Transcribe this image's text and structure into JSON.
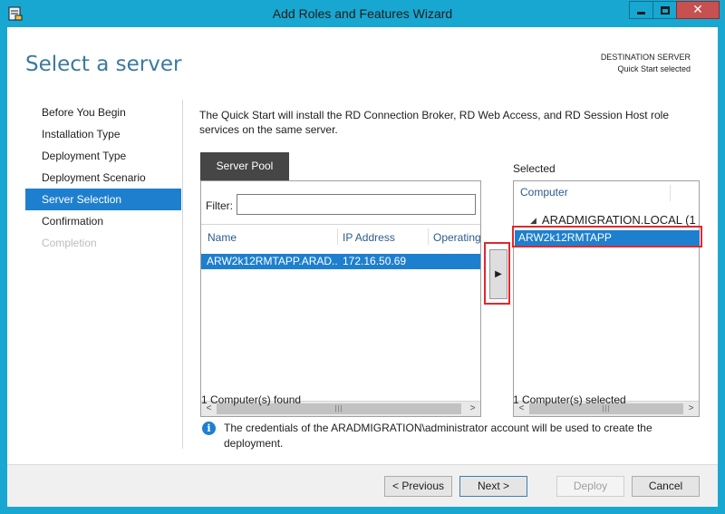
{
  "window": {
    "title": "Add Roles and Features Wizard",
    "close_glyph": "✕"
  },
  "page_title": "Select a server",
  "destination": {
    "label": "DESTINATION SERVER",
    "value": "Quick Start selected"
  },
  "nav": {
    "items": [
      {
        "label": "Before You Begin",
        "state": "normal"
      },
      {
        "label": "Installation Type",
        "state": "normal"
      },
      {
        "label": "Deployment Type",
        "state": "normal"
      },
      {
        "label": "Deployment Scenario",
        "state": "normal"
      },
      {
        "label": "Server Selection",
        "state": "active"
      },
      {
        "label": "Confirmation",
        "state": "normal"
      },
      {
        "label": "Completion",
        "state": "disabled"
      }
    ]
  },
  "intro_text": "The Quick Start will install the RD Connection Broker, RD Web Access, and RD Session Host role services on the same server.",
  "server_pool": {
    "tab_label": "Server Pool",
    "filter_label": "Filter:",
    "filter_value": "",
    "columns": [
      "Name",
      "IP Address",
      "Operating"
    ],
    "rows": [
      {
        "name": "ARW2k12RMTAPP.ARAD...",
        "ip": "172.16.50.69",
        "os": ""
      }
    ],
    "count_text": "1 Computer(s) found"
  },
  "add_button_glyph": "▶",
  "selected": {
    "label": "Selected",
    "column": "Computer",
    "group": "ARADMIGRATION.LOCAL (1",
    "group_glyph": "◢",
    "rows": [
      "ARW2k12RMTAPP"
    ],
    "count_text": "1 Computer(s) selected"
  },
  "info": {
    "icon": "i",
    "text": "The credentials of the ARADMIGRATION\\administrator account will be used to create the deployment."
  },
  "scrollbar": {
    "left_arrow": "<",
    "right_arrow": ">",
    "grip": "|||"
  },
  "buttons": {
    "previous": "< Previous",
    "next": "Next >",
    "deploy": "Deploy",
    "cancel": "Cancel"
  },
  "colors": {
    "titlebar": "#18a7d1",
    "accent": "#1e7fce",
    "close": "#c75050",
    "highlight_box": "#e0282c"
  }
}
